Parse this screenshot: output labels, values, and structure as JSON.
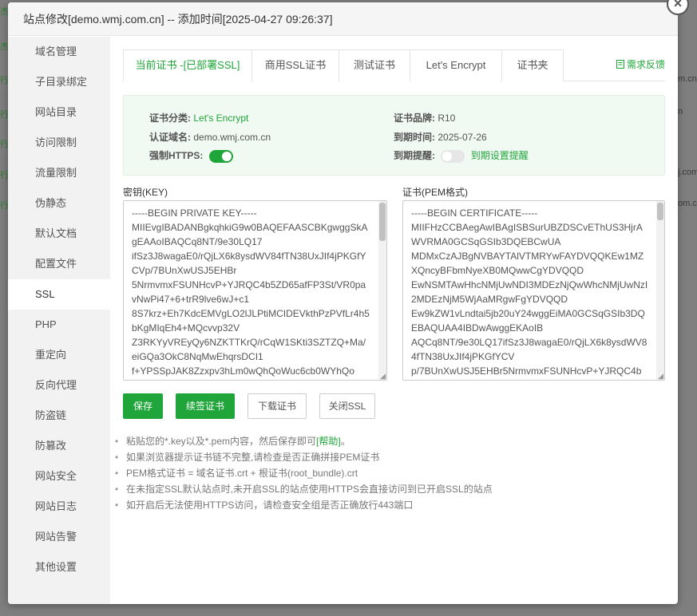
{
  "background": {
    "left_fragments": [
      "杰",
      "杰",
      "行",
      "",
      "行",
      "行",
      "行",
      "行"
    ],
    "right_fragments": [
      "m.cn",
      "n",
      "",
      "j.com",
      "om.cn"
    ]
  },
  "dialog": {
    "title": "站点修改[demo.wmj.com.cn] -- 添加时间[2025-04-27 09:26:37]",
    "close_icon": "×"
  },
  "sidebar": {
    "items": [
      {
        "label": "域名管理"
      },
      {
        "label": "子目录绑定"
      },
      {
        "label": "网站目录"
      },
      {
        "label": "访问限制"
      },
      {
        "label": "流量限制"
      },
      {
        "label": "伪静态"
      },
      {
        "label": "默认文档"
      },
      {
        "label": "配置文件"
      },
      {
        "label": "SSL",
        "active": true
      },
      {
        "label": "PHP"
      },
      {
        "label": "重定向"
      },
      {
        "label": "反向代理"
      },
      {
        "label": "防盗链"
      },
      {
        "label": "防篡改"
      },
      {
        "label": "网站安全"
      },
      {
        "label": "网站日志"
      },
      {
        "label": "网站告警"
      },
      {
        "label": "其他设置"
      }
    ]
  },
  "tabs": [
    {
      "label": "当前证书 -[已部署SSL]",
      "active": true
    },
    {
      "label": "商用SSL证书"
    },
    {
      "label": "测试证书"
    },
    {
      "label": "Let's Encrypt"
    },
    {
      "label": "证书夹"
    }
  ],
  "feedback": {
    "icon": "document-icon",
    "label": "需求反馈"
  },
  "cert_info": {
    "category_label": "证书分类:",
    "category_value": "Let's Encrypt",
    "brand_label": "证书品牌:",
    "brand_value": "R10",
    "domain_label": "认证域名:",
    "domain_value": "demo.wmj.com.cn",
    "expire_label": "到期时间:",
    "expire_value": "2025-07-26",
    "https_label": "强制HTTPS:",
    "https_enabled": true,
    "remind_label": "到期提醒:",
    "remind_enabled": false,
    "remind_link": "到期设置提醒"
  },
  "key_field": {
    "label": "密钥(KEY)",
    "value": "-----BEGIN PRIVATE KEY-----\nMIIEvgIBADANBgkqhkiG9w0BAQEFAASCBKgwggSkAgEAAoIBAQCq8NT/9e30LQ17\nifSz3J8wagaE0/rQjLX6k8ysdWV84fTN38UxJIf4jPKGfYCVp/7BUnXwUSJ5EHBr\n5NrmvmxFSUNHcvP+YJRQC4b5ZD65afFP3St/VR0pavNwPi47+6+trR9lve6wJ+c1\n8S7krz+Eh7KdcEMVgLO2lJLPtiMCIDEVkthPzPVfLr4h5bKgMIqEh4+MQcvvp32V\nZ3RKYyVREyQy6NZKTTKrQ/rCqW1SKti3SZTZQ+Ma/eiGQa3OkC8NqMwEhqrsDCI1\nf+YPSSpJAK8Zzxpv3hLm0wQhQoWuc6cb0WYhQo"
  },
  "cert_field": {
    "label": "证书(PEM格式)",
    "value": "-----BEGIN CERTIFICATE-----\nMIIFHzCCBAegAwIBAgISBSurUBZDSCvEThUS3HjrAWVRMA0GCSqGSIb3DQEBCwUA\nMDMxCzAJBgNVBAYTAlVTMRYwFAYDVQQKEw1MZXQncyBFbmNyeXB0MQwwCgYDVQQD\nEwNSMTAwHhcNMjUwNDI3MDEzNjQwWhcNMjUwNzI2MDEzNjM5WjAaMRgwFgYDVQQD\nEw9kZW1vLndtai5jb20uY24wggEiMA0GCSqGSIb3DQEBAQUAA4IBDwAwggEKAoIB\nAQCq8NT/9e30LQ17ifSz3J8wagaE0/rQjLX6k8ysdWV84fTN38UxJIf4jPKGfYCV\np/7BUnXwUSJ5EHBr5NrmvmxFSUNHcvP+YJRQC4b"
  },
  "buttons": {
    "save": "保存",
    "renew": "续签证书",
    "download": "下载证书",
    "close_ssl": "关闭SSL"
  },
  "tips": {
    "t1_text": "粘贴您的*.key以及*.pem内容，然后保存即可",
    "t1_link": "[帮助]",
    "t1_end": "。",
    "t2": "如果浏览器提示证书链不完整,请检查是否正确拼接PEM证书",
    "t3": "PEM格式证书 = 域名证书.crt + 根证书(root_bundle).crt",
    "t4": "在未指定SSL默认站点时,未开启SSL的站点使用HTTPS会直接访问到已开启SSL的站点",
    "t5": "如开启后无法使用HTTPS访问，请检查安全组是否正确放行443端口"
  },
  "colors": {
    "accent": "#20a53a",
    "info_bg": "#f1f9f3"
  }
}
